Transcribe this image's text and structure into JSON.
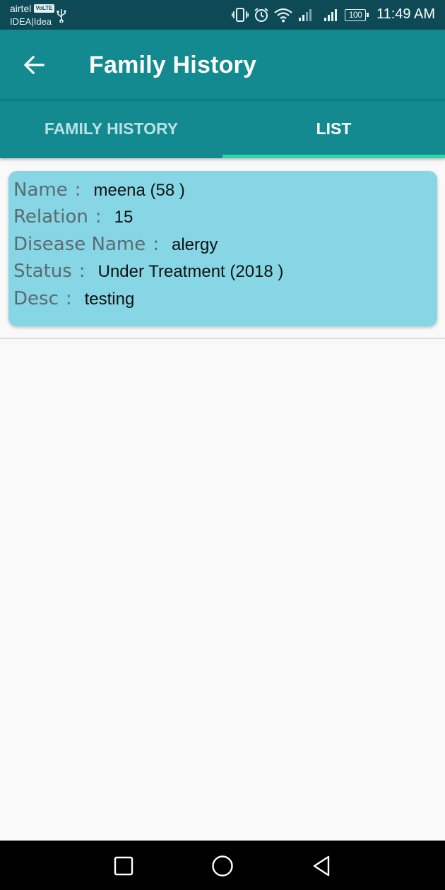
{
  "status_bar": {
    "carrier_primary": "airtel",
    "volte_badge": "VoLTE",
    "carrier_secondary": "IDEA|Idea",
    "battery_level": "100",
    "time": "11:49 AM",
    "icons": [
      "usb-icon",
      "vibrate-icon",
      "alarm-icon",
      "wifi-icon",
      "signal-icon",
      "signal-icon",
      "battery-icon"
    ]
  },
  "app_bar": {
    "title": "Family History",
    "back_icon": "arrow-left-icon",
    "color": "#128a90"
  },
  "tabs": [
    {
      "label": "FAMILY HISTORY",
      "selected": false
    },
    {
      "label": "LIST",
      "selected": true
    }
  ],
  "tab_indicator_color": "#2fd7a8",
  "records": [
    {
      "name_label": "Name",
      "name_value": "meena (58 )",
      "relation_label": "Relation",
      "relation_value": "15",
      "disease_label": "Disease Name",
      "disease_value": "alergy",
      "status_label": "Status",
      "status_value": "Under Treatment (2018 )",
      "desc_label": "Desc",
      "desc_value": "testing",
      "separator": ":"
    }
  ],
  "card_color": "#86d6e5",
  "nav_bar": {
    "icons": [
      "recent-apps-icon",
      "home-icon",
      "back-icon"
    ]
  }
}
